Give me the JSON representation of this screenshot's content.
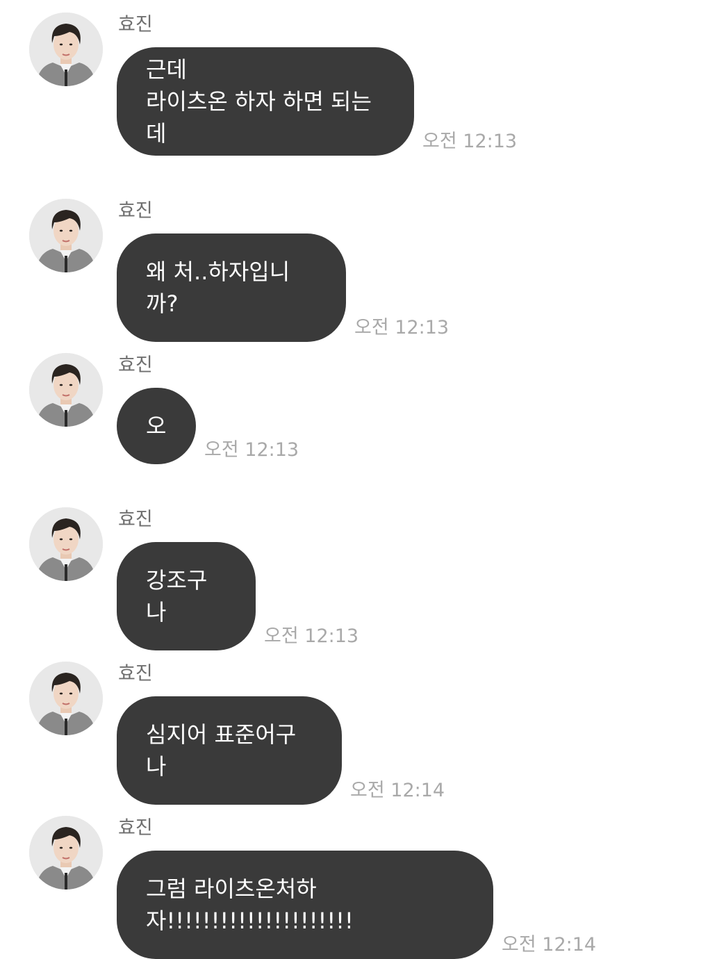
{
  "messages": [
    {
      "sender": "효진",
      "text": "근데\n라이츠온 하자 하면 되는데",
      "time": "오전 12:13"
    },
    {
      "sender": "효진",
      "text": "왜 처..하자입니까?",
      "time": "오전 12:13"
    },
    {
      "sender": "효진",
      "text": "오",
      "time": "오전 12:13"
    },
    {
      "sender": "효진",
      "text": "강조구나",
      "time": "오전 12:13"
    },
    {
      "sender": "효진",
      "text": "심지어 표준어구나",
      "time": "오전 12:14"
    },
    {
      "sender": "효진",
      "text": "그럼 라이츠온처하자!!!!!!!!!!!!!!!!!!!!!",
      "time": "오전 12:14"
    }
  ],
  "colors": {
    "bubble": "#3a3a3a",
    "bubble_text": "#ffffff",
    "sender_text": "#6f6f6f",
    "time_text": "#a9a9a9",
    "background": "#ffffff"
  },
  "icons": {
    "avatar": "profile-photo"
  }
}
